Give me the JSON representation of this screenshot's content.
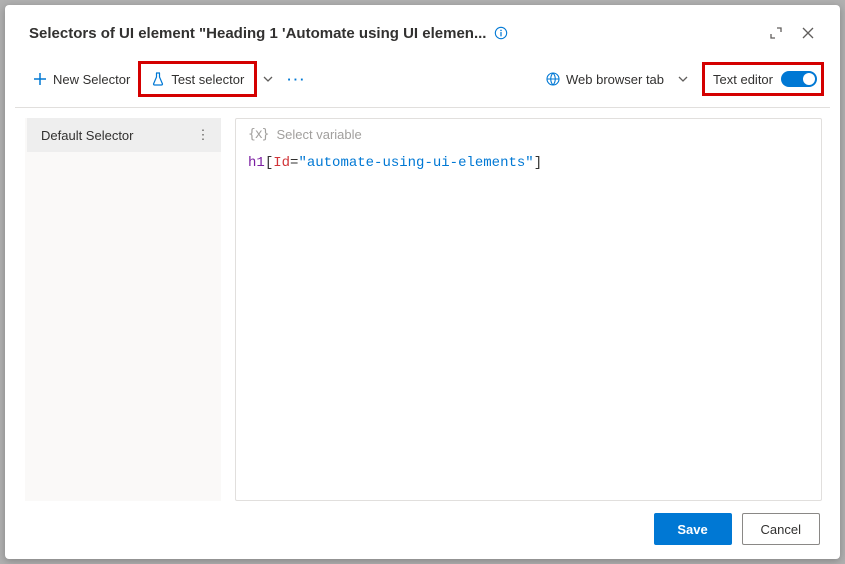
{
  "titlebar": {
    "title": "Selectors of UI element \"Heading 1 'Automate using UI elemen..."
  },
  "toolbar": {
    "new_selector_label": "New Selector",
    "test_selector_label": "Test selector",
    "webtab_label": "Web browser tab",
    "text_editor_label": "Text editor"
  },
  "sidebar": {
    "items": [
      {
        "label": "Default Selector"
      }
    ]
  },
  "editor": {
    "var_placeholder": "Select variable",
    "code": {
      "tag": "h1",
      "attr": "Id",
      "value": "automate-using-ui-elements"
    }
  },
  "footer": {
    "save_label": "Save",
    "cancel_label": "Cancel"
  }
}
